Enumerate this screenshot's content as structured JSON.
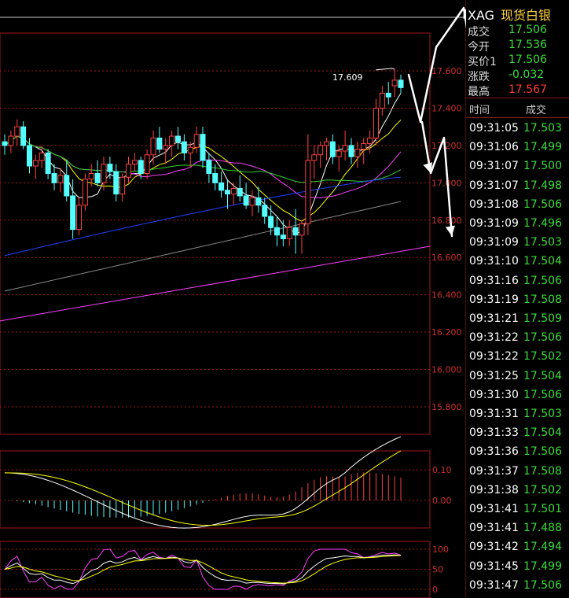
{
  "symbol": {
    "code": "XAG",
    "name": "现货白银"
  },
  "quote": [
    {
      "label": "成交",
      "value": "17.506",
      "color": "green"
    },
    {
      "label": "今开",
      "value": "17.536",
      "color": "green"
    },
    {
      "label": "买价1",
      "value": "17.506",
      "color": "green"
    },
    {
      "label": "涨跌",
      "value": "-0.032",
      "color": "green"
    },
    {
      "label": "最高",
      "value": "17.567",
      "color": "red"
    }
  ],
  "ticks_header": {
    "time": "时间",
    "price": "成交"
  },
  "ticks": [
    {
      "time": "09:31:05",
      "price": "17.503"
    },
    {
      "time": "09:31:06",
      "price": "17.499"
    },
    {
      "time": "09:31:07",
      "price": "17.500"
    },
    {
      "time": "09:31:07",
      "price": "17.498"
    },
    {
      "time": "09:31:08",
      "price": "17.506"
    },
    {
      "time": "09:31:09",
      "price": "17.496"
    },
    {
      "time": "09:31:09",
      "price": "17.503"
    },
    {
      "time": "09:31:10",
      "price": "17.504"
    },
    {
      "time": "09:31:16",
      "price": "17.506"
    },
    {
      "time": "09:31:19",
      "price": "17.508"
    },
    {
      "time": "09:31:21",
      "price": "17.509"
    },
    {
      "time": "09:31:22",
      "price": "17.506"
    },
    {
      "time": "09:31:22",
      "price": "17.502"
    },
    {
      "time": "09:31:25",
      "price": "17.504"
    },
    {
      "time": "09:31:30",
      "price": "17.506"
    },
    {
      "time": "09:31:31",
      "price": "17.503"
    },
    {
      "time": "09:31:33",
      "price": "17.504"
    },
    {
      "time": "09:31:36",
      "price": "17.506"
    },
    {
      "time": "09:31:37",
      "price": "17.508"
    },
    {
      "time": "09:31:38",
      "price": "17.502"
    },
    {
      "time": "09:31:41",
      "price": "17.501"
    },
    {
      "time": "09:31:41",
      "price": "17.488"
    },
    {
      "time": "09:31:42",
      "price": "17.494"
    },
    {
      "time": "09:31:45",
      "price": "17.499"
    },
    {
      "time": "09:31:47",
      "price": "17.506"
    }
  ],
  "chart": {
    "price_axis": [
      "17.600",
      "17.400",
      "17.200",
      "17.000",
      "16.800",
      "16.600",
      "16.400",
      "16.200",
      "16.000",
      "15.800"
    ],
    "high_label": "17.609",
    "macd_axis": [
      "0.10",
      "0.00"
    ],
    "kdj_axis": [
      "100",
      "50",
      "0"
    ],
    "price_range": [
      15.72,
      17.74
    ],
    "candles": [
      [
        17.22,
        17.26,
        17.15,
        17.2
      ],
      [
        17.2,
        17.28,
        17.16,
        17.25
      ],
      [
        17.25,
        17.34,
        17.2,
        17.3
      ],
      [
        17.3,
        17.33,
        17.18,
        17.2
      ],
      [
        17.2,
        17.24,
        17.05,
        17.09
      ],
      [
        17.09,
        17.15,
        17.02,
        17.12
      ],
      [
        17.12,
        17.2,
        17.08,
        17.16
      ],
      [
        17.16,
        17.18,
        17.02,
        17.05
      ],
      [
        17.05,
        17.1,
        16.96,
        17.0
      ],
      [
        17.0,
        17.08,
        16.95,
        17.04
      ],
      [
        17.04,
        17.12,
        16.9,
        16.93
      ],
      [
        16.93,
        17.02,
        16.7,
        16.75
      ],
      [
        16.75,
        16.92,
        16.72,
        16.88
      ],
      [
        16.88,
        17.05,
        16.85,
        17.02
      ],
      [
        17.02,
        17.1,
        16.98,
        17.05
      ],
      [
        17.05,
        17.12,
        16.98,
        17.0
      ],
      [
        17.0,
        17.14,
        16.96,
        17.1
      ],
      [
        17.1,
        17.14,
        17.02,
        17.06
      ],
      [
        17.06,
        17.1,
        16.9,
        16.94
      ],
      [
        16.94,
        17.05,
        16.9,
        17.03
      ],
      [
        17.03,
        17.14,
        17.0,
        17.1
      ],
      [
        17.1,
        17.16,
        17.06,
        17.12
      ],
      [
        17.12,
        17.14,
        17.02,
        17.05
      ],
      [
        17.05,
        17.18,
        17.02,
        17.15
      ],
      [
        17.15,
        17.28,
        17.1,
        17.24
      ],
      [
        17.24,
        17.3,
        17.16,
        17.18
      ],
      [
        17.18,
        17.24,
        17.1,
        17.2
      ],
      [
        17.2,
        17.28,
        17.14,
        17.25
      ],
      [
        17.25,
        17.3,
        17.18,
        17.22
      ],
      [
        17.22,
        17.26,
        17.12,
        17.16
      ],
      [
        17.16,
        17.22,
        17.08,
        17.19
      ],
      [
        17.19,
        17.3,
        17.16,
        17.26
      ],
      [
        17.26,
        17.3,
        17.08,
        17.12
      ],
      [
        17.12,
        17.16,
        17.0,
        17.05
      ],
      [
        17.05,
        17.1,
        16.96,
        17.0
      ],
      [
        17.0,
        17.06,
        16.92,
        16.96
      ],
      [
        16.96,
        17.02,
        16.86,
        16.94
      ],
      [
        16.94,
        17.0,
        16.88,
        16.97
      ],
      [
        16.97,
        17.04,
        16.9,
        16.93
      ],
      [
        16.93,
        17.0,
        16.86,
        16.88
      ],
      [
        16.88,
        16.96,
        16.82,
        16.92
      ],
      [
        16.92,
        16.98,
        16.84,
        16.88
      ],
      [
        16.88,
        16.92,
        16.78,
        16.82
      ],
      [
        16.82,
        16.88,
        16.72,
        16.76
      ],
      [
        16.76,
        16.82,
        16.66,
        16.72
      ],
      [
        16.72,
        16.8,
        16.66,
        16.7
      ],
      [
        16.7,
        16.8,
        16.66,
        16.76
      ],
      [
        16.76,
        16.86,
        16.62,
        16.72
      ],
      [
        16.72,
        16.8,
        16.62,
        16.78
      ],
      [
        16.78,
        17.26,
        16.72,
        17.12
      ],
      [
        17.12,
        17.2,
        17.02,
        17.15
      ],
      [
        17.15,
        17.22,
        17.08,
        17.2
      ],
      [
        17.2,
        17.24,
        17.12,
        17.22
      ],
      [
        17.22,
        17.26,
        17.1,
        17.14
      ],
      [
        17.14,
        17.2,
        17.06,
        17.17
      ],
      [
        17.17,
        17.28,
        17.12,
        17.2
      ],
      [
        17.2,
        17.24,
        17.1,
        17.14
      ],
      [
        17.14,
        17.22,
        17.08,
        17.18
      ],
      [
        17.18,
        17.24,
        17.1,
        17.21
      ],
      [
        17.21,
        17.28,
        17.16,
        17.24
      ],
      [
        17.24,
        17.45,
        17.2,
        17.4
      ],
      [
        17.4,
        17.52,
        17.36,
        17.48
      ],
      [
        17.48,
        17.54,
        17.42,
        17.46
      ],
      [
        17.52,
        17.609,
        17.46,
        17.55
      ],
      [
        17.55,
        17.58,
        17.48,
        17.51
      ]
    ]
  }
}
